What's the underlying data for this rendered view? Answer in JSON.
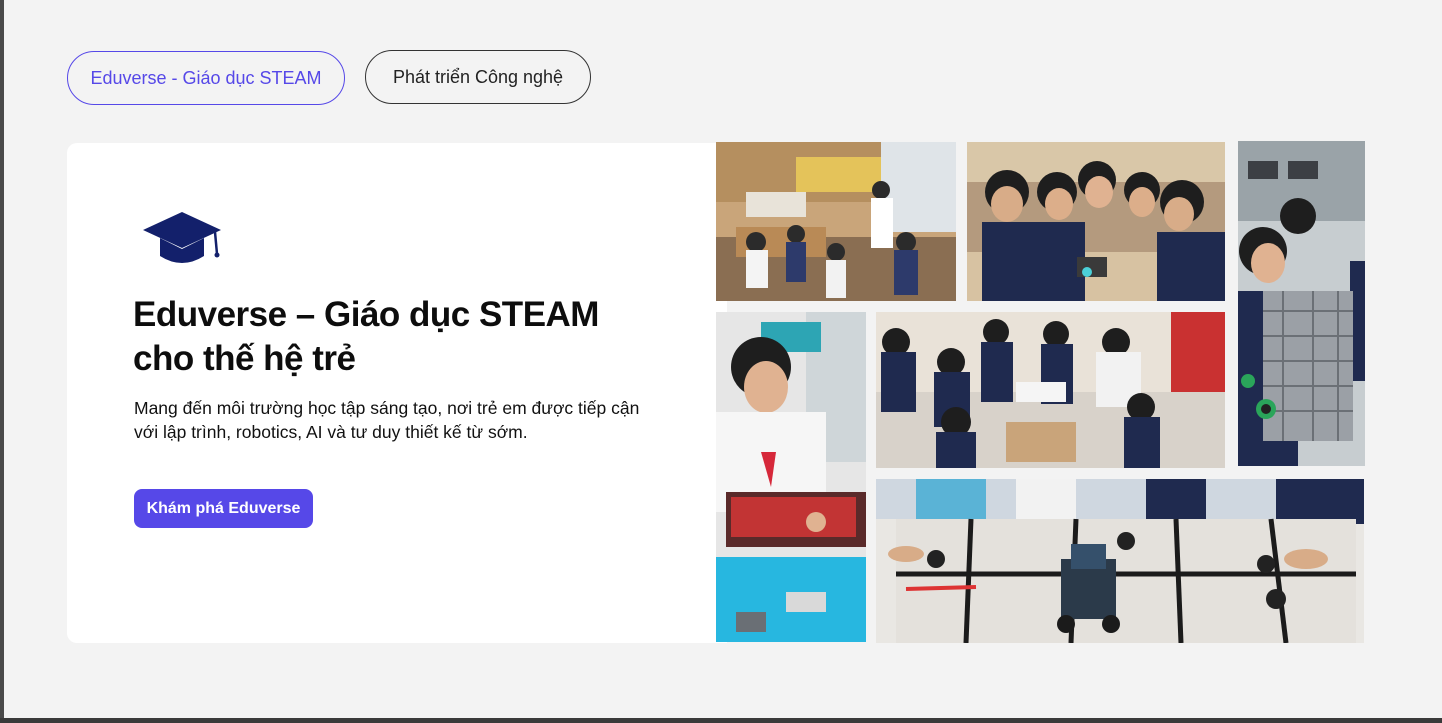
{
  "tabs": [
    {
      "label": "Eduverse - Giáo dục STEAM",
      "active": true
    },
    {
      "label": "Phát triển Công nghệ",
      "active": false
    }
  ],
  "hero": {
    "icon": "graduation-cap-icon",
    "title_line1": "Eduverse – Giáo dục STEAM",
    "title_line2": "cho thế hệ trẻ",
    "description_line1": "Mang đến môi trường học tập sáng tạo, nơi trẻ em được tiếp cận",
    "description_line2": "với lập trình, robotics, AI và tư duy thiết kế từ sớm.",
    "cta_label": "Khám phá Eduverse"
  },
  "colors": {
    "accent": "#5648e8",
    "icon_navy": "#13206b",
    "background": "#f3f3f3",
    "card": "#ffffff"
  },
  "photos": [
    {
      "name": "classroom-photo"
    },
    {
      "name": "students-robot-photo"
    },
    {
      "name": "student-robot-arm-photo"
    },
    {
      "name": "student-workshop-photo"
    },
    {
      "name": "group-building-photo"
    },
    {
      "name": "vex-field-photo"
    }
  ]
}
